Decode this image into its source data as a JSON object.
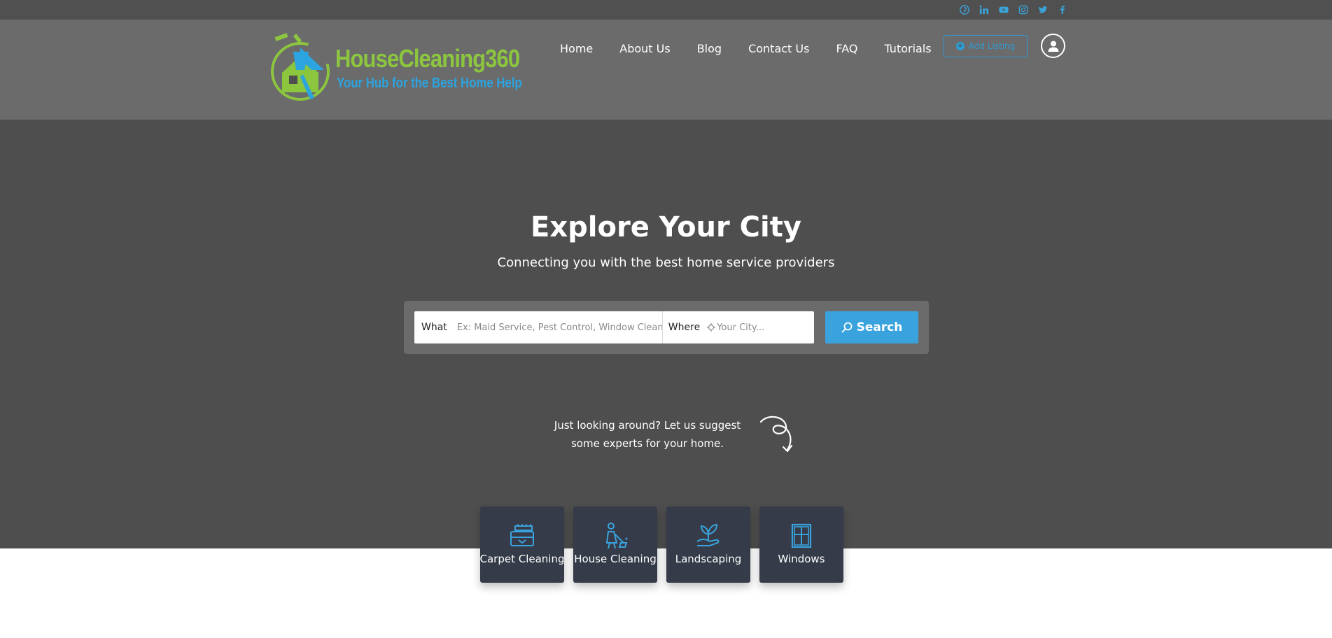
{
  "topbar": {
    "social_icons": [
      "pinterest-icon",
      "linkedin-icon",
      "youtube-icon",
      "instagram-icon",
      "twitter-icon",
      "facebook-icon"
    ],
    "icon_color": "#3aa3d8"
  },
  "header": {
    "logo": {
      "title": "HouseCleaning360",
      "tagline": "Your Hub for the Best Home Help"
    },
    "nav": [
      "Home",
      "About Us",
      "Blog",
      "Contact Us",
      "FAQ",
      "Tutorials"
    ],
    "add_listing_label": "Add Listing",
    "user_icon": "user-icon"
  },
  "hero": {
    "title": "Explore Your City",
    "subtitle": "Connecting you with the best home service providers",
    "search": {
      "what_label": "What",
      "what_placeholder": "Ex: Maid Service, Pest Control, Window Cleaning",
      "where_label": "Where",
      "where_placeholder": "Your City...",
      "button_label": "Search"
    },
    "suggest_text": "Just looking around? Let us suggest some experts for your home."
  },
  "categories": [
    {
      "label": "Carpet Cleaning",
      "icon": "carpet-cleaning-icon"
    },
    {
      "label": "House Cleaning",
      "icon": "house-cleaning-icon"
    },
    {
      "label": "Landscaping",
      "icon": "landscaping-icon"
    },
    {
      "label": "Windows",
      "icon": "window-icon"
    }
  ],
  "colors": {
    "accent": "#3aa3de",
    "logo_green": "#8cc63f",
    "logo_blue": "#2ba4e0",
    "hero_bg": "#4e4e4e",
    "header_bg": "#6b6b6b",
    "card_bg": "#353b48"
  }
}
